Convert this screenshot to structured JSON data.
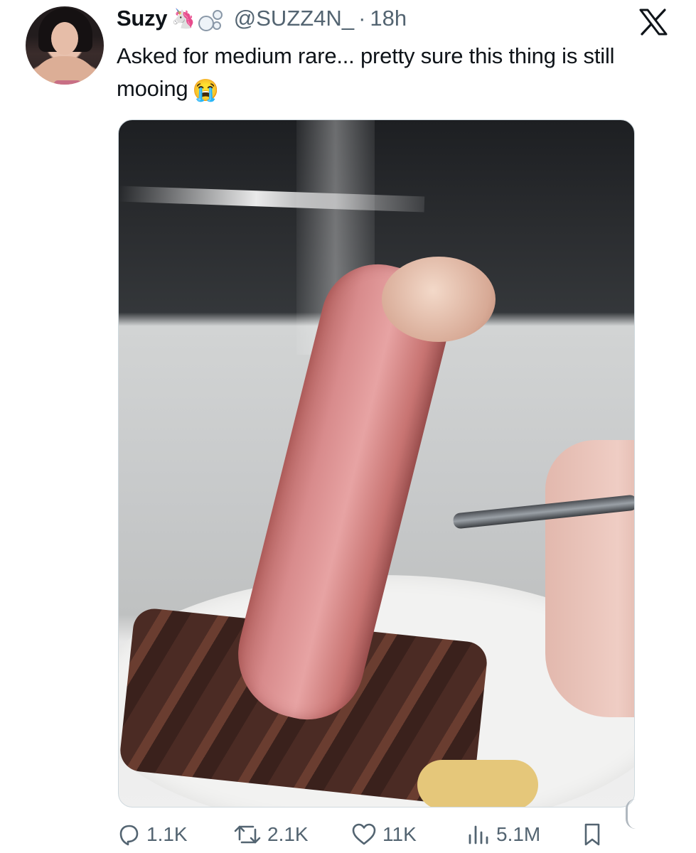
{
  "tweet": {
    "display_name": "Suzy",
    "name_emoji": "🦄",
    "handle": "@SUZZ4N_",
    "separator": "·",
    "time": "18h",
    "text": "Asked for medium rare... pretty sure this thing is still mooing",
    "text_emoji": "😭"
  },
  "actions": {
    "replies": "1.1K",
    "reposts": "2.1K",
    "likes": "11K",
    "views": "5.1M"
  },
  "icons": {
    "brand": "x-logo-icon",
    "reply": "reply-icon",
    "repost": "repost-icon",
    "like": "heart-icon",
    "views": "views-chart-icon",
    "bookmark": "bookmark-icon"
  },
  "colors": {
    "text_primary": "#0f1419",
    "text_secondary": "#536471"
  }
}
